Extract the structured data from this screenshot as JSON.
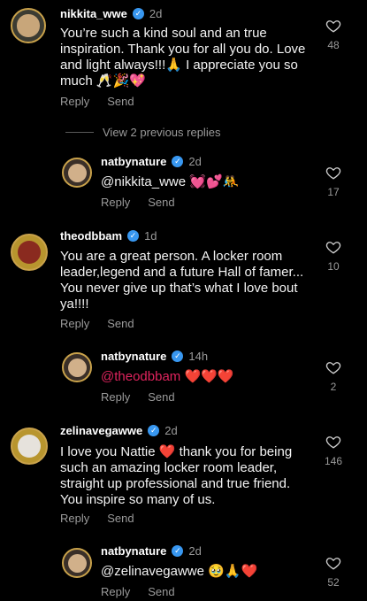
{
  "comments": [
    {
      "username": "nikkita_wwe",
      "time": "2d",
      "lines": [
        "You’re such a kind soul and an true",
        "inspiration. Thank you for all you do. Love",
        "and light always!!!🙏 I appreciate you so",
        "much 🥂🎉💖"
      ],
      "actions": [
        "Reply",
        "Send"
      ],
      "likes": "48"
    },
    {
      "username": "natbynature",
      "time": "2d",
      "lines": [
        "@nikkita_wwe 💓💕🤼"
      ],
      "actions": [
        "Reply",
        "Send"
      ],
      "likes": "17"
    },
    {
      "username": "theodbbam",
      "time": "1d",
      "lines": [
        "You are a great person. A locker room",
        "leader,legend and a future Hall of famer...",
        "You never give up that’s what I love bout",
        "ya!!!!"
      ],
      "actions": [
        "Reply",
        "Send"
      ],
      "likes": "10"
    },
    {
      "username": "natbynature",
      "time": "14h",
      "lines": [
        "@theodbbam ❤️❤️❤️"
      ],
      "actions": [
        "Reply",
        "Send"
      ],
      "likes": "2"
    },
    {
      "username": "zelinavegawwe",
      "time": "2d",
      "lines": [
        "I love you Nattie ❤️ thank you for being",
        "such an amazing locker room leader,",
        "straight up professional and true friend.",
        "You inspire so many of us."
      ],
      "actions": [
        "Reply",
        "Send"
      ],
      "likes": "146"
    },
    {
      "username": "natbynature",
      "time": "2d",
      "lines": [
        "@zelinavegawwe 🥹🙏❤️"
      ],
      "actions": [
        "Reply",
        "Send"
      ],
      "likes": "52"
    }
  ],
  "view_previous": "View 2 previous replies",
  "colors": {
    "background": "#000000",
    "verified": "#3897f0",
    "muted": "#9a9a9a"
  }
}
